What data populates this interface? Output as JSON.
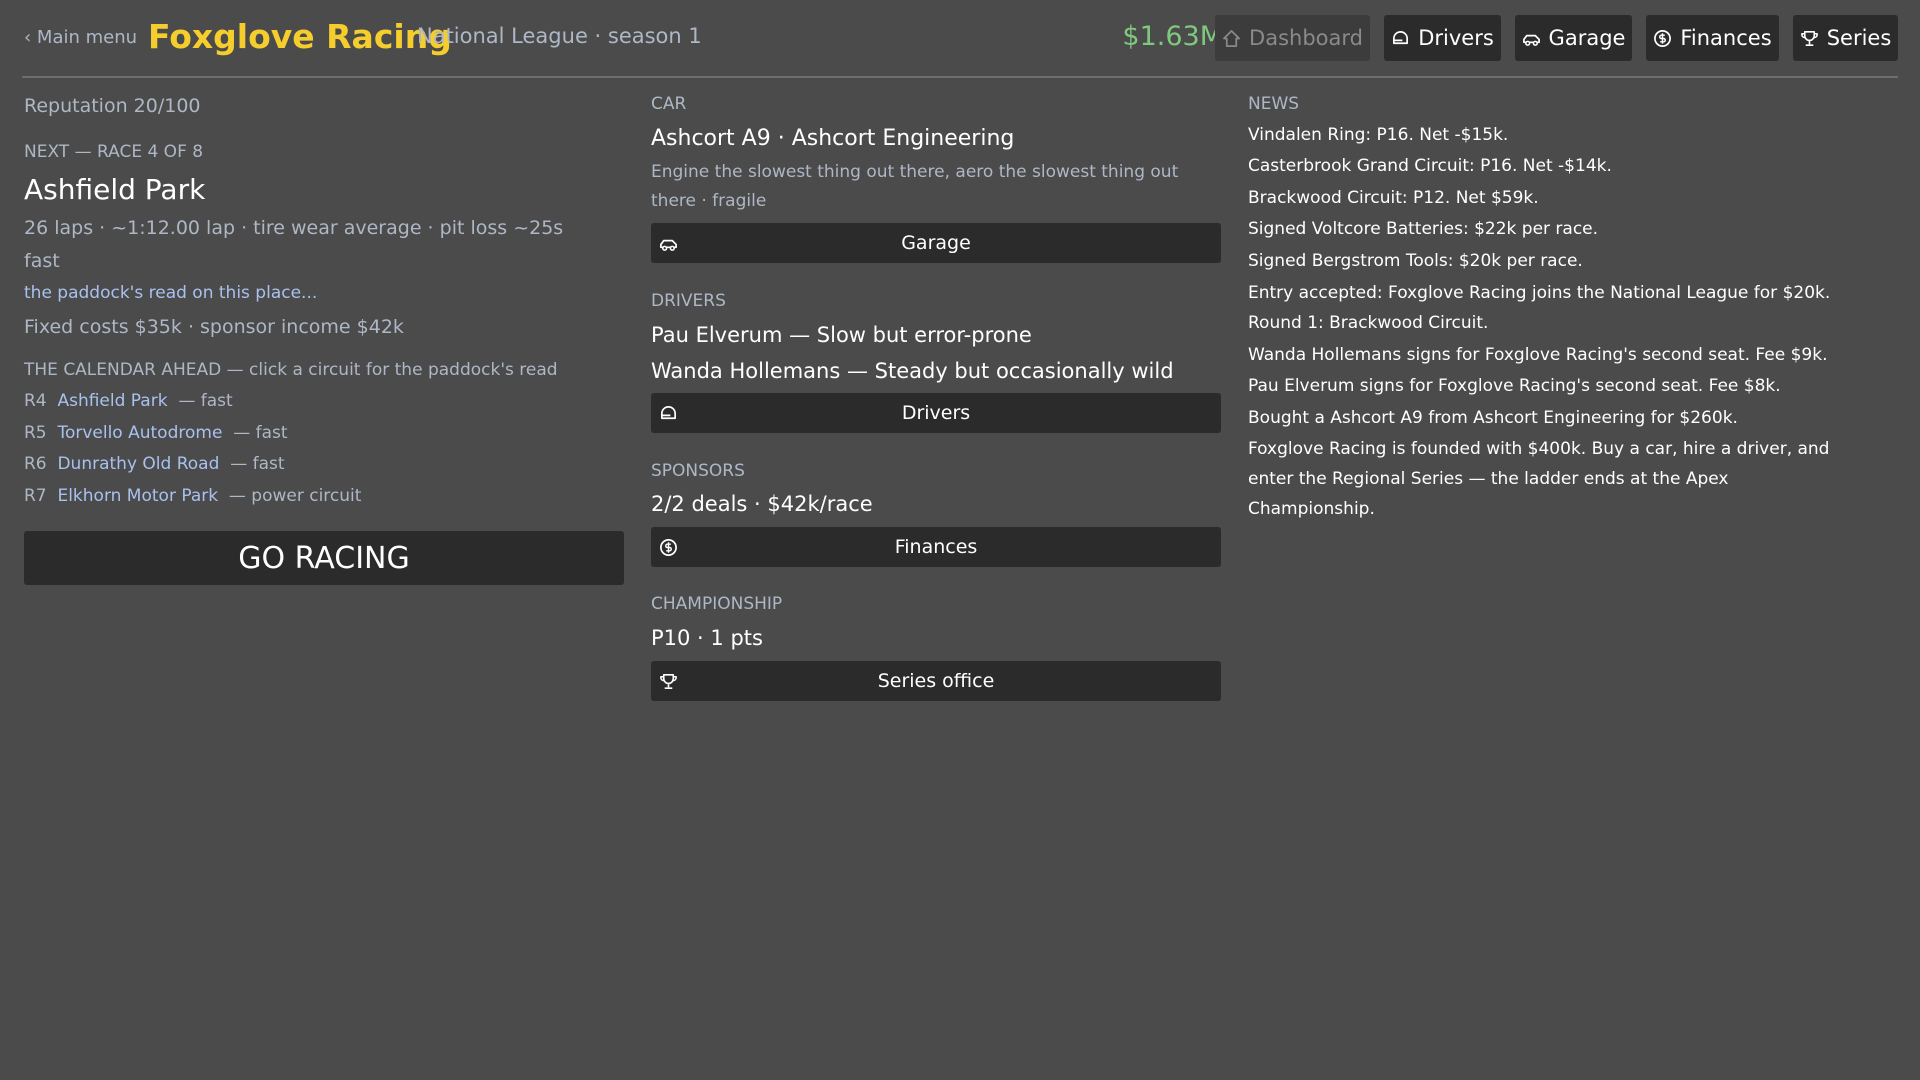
{
  "header": {
    "back_label": "‹ Main menu",
    "team_name": "Foxglove Racing",
    "league": "National League · season 1",
    "money": "$1.63M",
    "nav": [
      {
        "label": "Dashboard",
        "icon": "home-icon",
        "disabled": true
      },
      {
        "label": "Drivers",
        "icon": "helmet-icon"
      },
      {
        "label": "Garage",
        "icon": "car-icon"
      },
      {
        "label": "Finances",
        "icon": "coin-icon"
      },
      {
        "label": "Series",
        "icon": "trophy-icon"
      }
    ]
  },
  "left": {
    "reputation": "Reputation 20/100",
    "next_label": "NEXT — RACE 4 OF 8",
    "track_name": "Ashfield Park",
    "track_details": "26 laps · ~1:12.00 lap · tire wear average · pit loss ~25s",
    "track_type": "fast",
    "paddock_link": "the paddock's read on this place...",
    "costs": "Fixed costs $35k · sponsor income $42k",
    "calendar_label": "THE CALENDAR AHEAD — click a circuit for the paddock's read",
    "calendar": [
      {
        "round": "R4",
        "name": "Ashfield Park",
        "type": "— fast"
      },
      {
        "round": "R5",
        "name": "Torvello Autodrome",
        "type": "— fast"
      },
      {
        "round": "R6",
        "name": "Dunrathy Old Road",
        "type": "— fast"
      },
      {
        "round": "R7",
        "name": "Elkhorn Motor Park",
        "type": "— power circuit"
      }
    ],
    "go_label": "GO RACING"
  },
  "mid": {
    "car_label": "CAR",
    "car_name": "Ashcort A9 · Ashcort Engineering",
    "car_desc_1": "Engine the slowest thing out there, aero the slowest thing out",
    "car_desc_2": "there · fragile",
    "garage_btn": "Garage",
    "drivers_label": "DRIVERS",
    "driver_1": "Pau Elverum — Slow but error-prone",
    "driver_2": "Wanda Hollemans — Steady but occasionally wild",
    "drivers_btn": "Drivers",
    "sponsors_label": "SPONSORS",
    "sponsors_value": "2/2 deals · $42k/race",
    "finances_btn": "Finances",
    "championship_label": "CHAMPIONSHIP",
    "championship_value": "P10 · 1 pts",
    "series_btn": "Series office"
  },
  "news": {
    "label": "NEWS",
    "items": [
      "Vindalen Ring: P16. Net -$15k.",
      "Casterbrook Grand Circuit: P16. Net -$14k.",
      "Brackwood Circuit: P12. Net $59k.",
      "Signed Voltcore Batteries: $22k per race.",
      "Signed Bergstrom Tools: $20k per race.",
      "Entry accepted: Foxglove Racing joins the National League for $20k.",
      "Round 1: Brackwood Circuit.",
      "Wanda Hollemans signs for Foxglove Racing's second seat. Fee $9k.",
      "Pau Elverum signs for Foxglove Racing's second seat. Fee $8k.",
      "Bought a Ashcort A9 from Ashcort Engineering for $260k.",
      "Foxglove Racing is founded with $400k. Buy a car, hire a driver, and",
      "enter the Regional Series — the ladder ends at the Apex",
      "Championship."
    ]
  },
  "colors": {
    "background": "#4b4b4b",
    "accent_team": "#f5cd2d",
    "money": "#7fc97f",
    "link": "#a9c1ee",
    "muted": "#aeb7c6",
    "button": "#2b2b2b"
  }
}
